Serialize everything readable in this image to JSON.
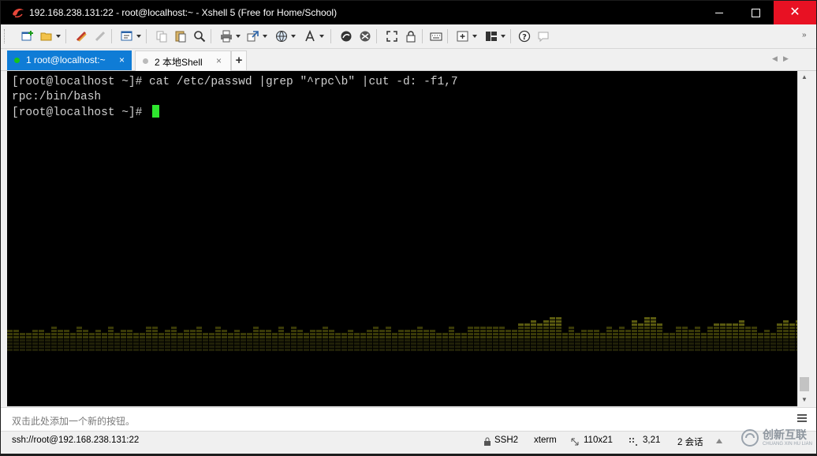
{
  "window": {
    "title": "192.168.238.131:22 - root@localhost:~ - Xshell 5 (Free for Home/School)",
    "controls": {
      "minimize": "",
      "maximize": "",
      "close": "✕"
    }
  },
  "toolbar": {
    "overflow": "»",
    "icons": [
      "new-session-icon",
      "open-folder-icon",
      "reconnect-icon",
      "disconnect-icon",
      "properties-icon",
      "copy-icon",
      "paste-icon",
      "find-icon",
      "print-icon",
      "transfer-icon",
      "globe-icon",
      "font-icon",
      "xftp-icon",
      "xmanager-icon",
      "fullscreen-icon",
      "lock-icon",
      "keyboard-icon",
      "add-tab-icon",
      "layout-icon",
      "help-icon",
      "chat-icon"
    ]
  },
  "tabs": [
    {
      "label": "1 root@localhost:~",
      "close": "×",
      "status_color": "#18c418"
    },
    {
      "label": "2 本地Shell",
      "close": "×",
      "status_color": "#bbbbbb"
    }
  ],
  "tabbar": {
    "add_label": "+",
    "nav_prev": "◀",
    "nav_next": "▶"
  },
  "terminal": {
    "lines": [
      "[root@localhost ~]# cat /etc/passwd |grep \"^rpc\\b\" |cut -d: -f1,7",
      "rpc:/bin/bash",
      "[root@localhost ~]# "
    ],
    "cursor_color": "#2ee62e",
    "text_color": "#cfcfcf",
    "background": "#000000"
  },
  "scrollbar": {
    "up_arrow": "▲",
    "down_arrow": "▼"
  },
  "quick_bar": {
    "hint": "双击此处添加一个新的按钮。"
  },
  "status": {
    "connection": "ssh://root@192.168.238.131:22",
    "protocol": "SSH2",
    "terminal_type": "xterm",
    "size": "110x21",
    "cursor_pos": "3,21",
    "sessions": "2 会话"
  },
  "watermark": {
    "brand": "创新互联",
    "sub": "CHUANG XIN HU LIAN"
  },
  "colors": {
    "tab_active": "#0f7cd6",
    "close_button": "#e81123",
    "titlebar": "#000000"
  }
}
